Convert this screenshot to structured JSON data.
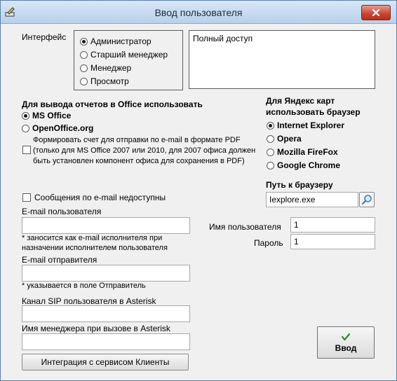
{
  "window": {
    "title": "Ввод пользователя",
    "app_icon": "app-pencil-icon",
    "close_icon": "close-icon"
  },
  "interface": {
    "label": "Интерфейс",
    "options": [
      "Администратор",
      "Старший менеджер",
      "Менеджер",
      "Просмотр"
    ],
    "selected_index": 0,
    "description": "Полный доступ"
  },
  "office": {
    "heading": "Для вывода отчетов в Office использовать",
    "options": [
      "MS Office",
      "OpenOffice.org"
    ],
    "selected_index": 0,
    "pdf_checkbox_text_1": "Формировать счет для отправки по e-mail в формате PDF",
    "pdf_checkbox_text_2": "(только для MS Office 2007 или 2010, для 2007 офиса должен",
    "pdf_checkbox_text_3": "быть установлен компонент офиса для  сохранения в PDF)"
  },
  "yandex": {
    "heading_1": "Для Яндекс карт",
    "heading_2": "использовать браузер",
    "options": [
      "Internet Explorer",
      "Opera",
      "Mozilla FireFox",
      "Google Chrome"
    ],
    "selected_index": 0,
    "browser_path_label": "Путь к браузеру",
    "browser_path_value": "Iexplore.exe",
    "browse_icon": "search-icon"
  },
  "email": {
    "unavailable_label": "Сообщения по e-mail недоступны",
    "user_email_label": "E-mail пользователя",
    "user_email_value": "",
    "user_email_note_1": "* заносится как e-mail исполнителя при",
    "user_email_note_2": "назначении исполнителем пользователя",
    "sender_email_label": "E-mail отправителя",
    "sender_email_value": "",
    "sender_email_note": "* указывается в поле Отправитель"
  },
  "asterisk": {
    "sip_label": "Канал SIP пользователя в Asterisk",
    "sip_value": "",
    "manager_label": "Имя менеджера при вызове в Asterisk",
    "manager_value": ""
  },
  "credentials": {
    "username_label": "Имя пользователя",
    "username_value": "1",
    "password_label": "Пароль",
    "password_value": "1"
  },
  "buttons": {
    "integration_label": "Интеграция с сервисом Клиенты",
    "enter_label": "Ввод",
    "enter_icon": "checkmark-icon"
  },
  "colors": {
    "checkmark": "#2e8b2e",
    "close_button": "#c74433"
  }
}
